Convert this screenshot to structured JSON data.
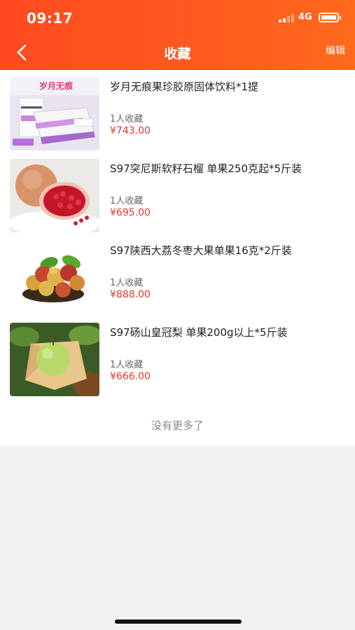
{
  "status_bar": {
    "time": "09:17",
    "network": "4G"
  },
  "nav": {
    "title": "收藏",
    "edit_label": "编辑"
  },
  "items": [
    {
      "title": "岁月无痕果珍胶原固体饮料*1提",
      "favorites": "1人收藏",
      "price": "¥743.00",
      "image": "collagen-drink-box"
    },
    {
      "title": "S97突尼斯软籽石榴 单果250克起*5斤装",
      "favorites": "1人收藏",
      "price": "¥695.00",
      "image": "pomegranate"
    },
    {
      "title": "S97陕西大荔冬枣大果单果16克*2斤装",
      "favorites": "1人收藏",
      "price": "¥888.00",
      "image": "winter-jujube"
    },
    {
      "title": "S97砀山皇冠梨 单果200g以上*5斤装",
      "favorites": "1人收藏",
      "price": "¥666.00",
      "image": "crown-pear"
    }
  ],
  "thumb_texts": {
    "brand": "岁月无痕"
  },
  "footer": {
    "no_more": "没有更多了"
  },
  "colors": {
    "header": "#ff5a1f",
    "price": "#e8352e",
    "background": "#f2f2f2"
  }
}
